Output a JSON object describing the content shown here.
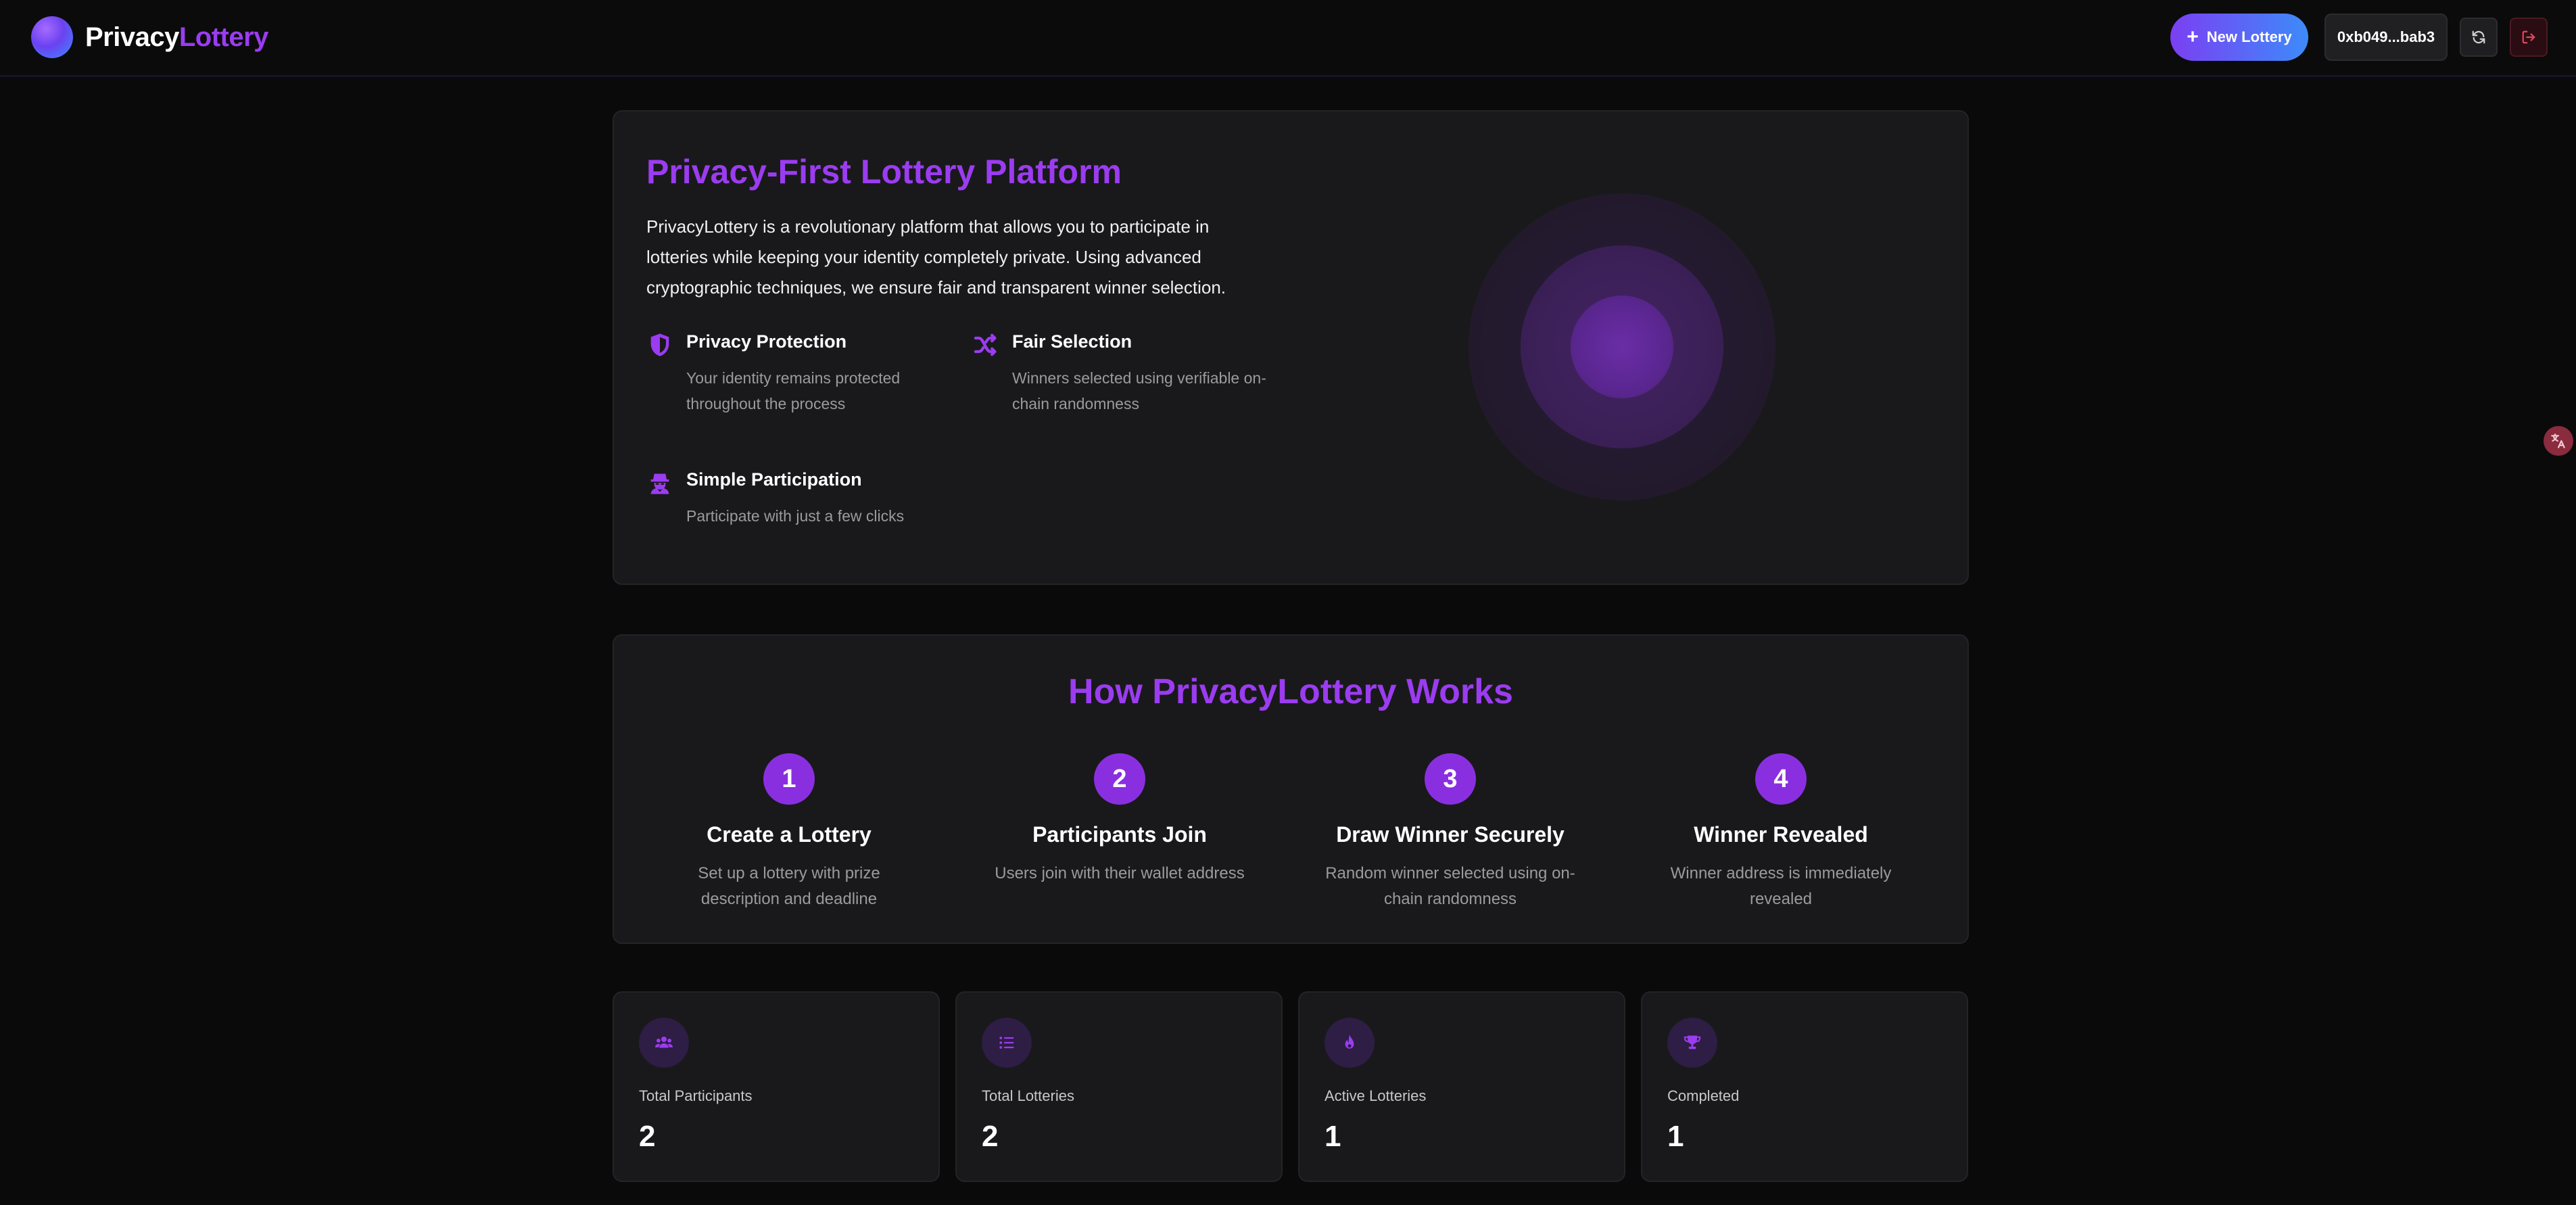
{
  "header": {
    "brand_part1": "Privacy",
    "brand_part2": "Lottery",
    "new_lottery_label": "New Lottery",
    "wallet_address": "0xb049...bab3",
    "refresh_icon": "refresh-icon",
    "logout_icon": "logout-icon"
  },
  "hero": {
    "title": "Privacy-First Lottery Platform",
    "description": "PrivacyLottery is a revolutionary platform that allows you to participate in lotteries while keeping your identity completely private. Using advanced cryptographic techniques, we ensure fair and transparent winner selection.",
    "features": [
      {
        "icon": "shield-icon",
        "title": "Privacy Protection",
        "description": "Your identity remains protected throughout the process"
      },
      {
        "icon": "shuffle-icon",
        "title": "Fair Selection",
        "description": "Winners selected using verifiable on-chain randomness"
      },
      {
        "icon": "user-secret-icon",
        "title": "Simple Participation",
        "description": "Participate with just a few clicks"
      }
    ]
  },
  "how": {
    "title": "How PrivacyLottery Works",
    "steps": [
      {
        "number": "1",
        "title": "Create a Lottery",
        "description": "Set up a lottery with prize description and deadline"
      },
      {
        "number": "2",
        "title": "Participants Join",
        "description": "Users join with their wallet address"
      },
      {
        "number": "3",
        "title": "Draw Winner Securely",
        "description": "Random winner selected using on-chain randomness"
      },
      {
        "number": "4",
        "title": "Winner Revealed",
        "description": "Winner address is immediately revealed"
      }
    ]
  },
  "stats": [
    {
      "icon": "users-icon",
      "label": "Total Participants",
      "value": "2"
    },
    {
      "icon": "list-icon",
      "label": "Total Lotteries",
      "value": "2"
    },
    {
      "icon": "fire-icon",
      "label": "Active Lotteries",
      "value": "1"
    },
    {
      "icon": "trophy-icon",
      "label": "Completed",
      "value": "1"
    }
  ],
  "colors": {
    "accent": "#9b3cf0",
    "background": "#0a0a0b",
    "card": "#19191b",
    "muted_text": "#9a9aa0"
  }
}
